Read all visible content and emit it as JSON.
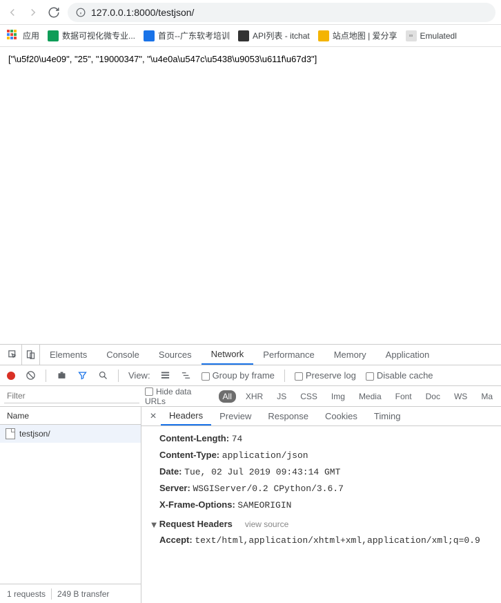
{
  "nav": {
    "url": "127.0.0.1:8000/testjson/"
  },
  "bookmarks": {
    "apps": "应用",
    "items": [
      "数据可视化微专业...",
      "首页--广东软考培训",
      "API列表 - itchat",
      "站点地图 | 爱分享",
      "Emulatedl"
    ]
  },
  "page": {
    "content": "[\"\\u5f20\\u4e09\", \"25\", \"19000347\", \"\\u4e0a\\u547c\\u5438\\u9053\\u611f\\u67d3\"]"
  },
  "devtools": {
    "tabs": [
      "Elements",
      "Console",
      "Sources",
      "Network",
      "Performance",
      "Memory",
      "Application"
    ],
    "active_tab": "Network",
    "toolbar": {
      "view_label": "View:",
      "group_label": "Group by frame",
      "preserve_label": "Preserve log",
      "disable_label": "Disable cache"
    },
    "filter": {
      "placeholder": "Filter",
      "hide_label": "Hide data URLs",
      "types": [
        "All",
        "XHR",
        "JS",
        "CSS",
        "Img",
        "Media",
        "Font",
        "Doc",
        "WS",
        "Ma"
      ]
    },
    "requests": {
      "name_header": "Name",
      "items": [
        "testjson/"
      ]
    },
    "detail_tabs": [
      "Headers",
      "Preview",
      "Response",
      "Cookies",
      "Timing"
    ],
    "detail_active": "Headers",
    "response_headers": [
      {
        "k": "Content-Length:",
        "v": "74"
      },
      {
        "k": "Content-Type:",
        "v": "application/json"
      },
      {
        "k": "Date:",
        "v": "Tue, 02 Jul 2019 09:43:14 GMT"
      },
      {
        "k": "Server:",
        "v": "WSGIServer/0.2 CPython/3.6.7"
      },
      {
        "k": "X-Frame-Options:",
        "v": "SAMEORIGIN"
      }
    ],
    "req_section": "Request Headers",
    "view_source": "view source",
    "request_headers": [
      {
        "k": "Accept:",
        "v": "text/html,application/xhtml+xml,application/xml;q=0.9"
      }
    ],
    "status": {
      "requests": "1 requests",
      "transfer": "249 B transfer"
    }
  }
}
